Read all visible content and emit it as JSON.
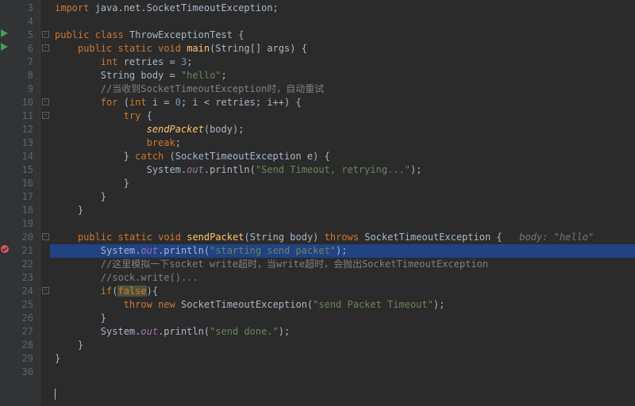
{
  "lines": {
    "start": 3,
    "end": 30
  },
  "code": {
    "l3": {
      "import": "import",
      "pkg": " java.net.SocketTimeoutException;"
    },
    "l5": {
      "k1": "public",
      "k2": "class",
      "cls": "ThrowExceptionTest",
      "brace": " {"
    },
    "l6": {
      "k1": "public",
      "k2": "static",
      "k3": "void",
      "fn": "main",
      "sig": "(String[] args) {"
    },
    "l7": {
      "k1": "int",
      "var": " retries = ",
      "num": "3",
      "semi": ";"
    },
    "l8": {
      "t1": "String body = ",
      "str": "\"hello\"",
      "semi": ";"
    },
    "l9": {
      "cmt": "//当收到SocketTimeoutException时，自动重试"
    },
    "l10": {
      "k1": "for",
      "open": " (",
      "k2": "int",
      "t1": " i = ",
      "n0": "0",
      "t2": "; i < retries; i++) {"
    },
    "l11": {
      "k1": "try",
      "brace": " {"
    },
    "l12": {
      "fn": "sendPacket",
      "t1": "(body);"
    },
    "l13": {
      "k1": "break",
      "semi": ";"
    },
    "l14": {
      "t1": "} ",
      "k1": "catch",
      "t2": " (SocketTimeoutException e) {"
    },
    "l15": {
      "t1": "System.",
      "fld": "out",
      "t2": ".println(",
      "str": "\"Send Timeout, retrying...\"",
      "t3": ");"
    },
    "l16": {
      "brace": "}"
    },
    "l17": {
      "brace": "}"
    },
    "l18": {
      "brace": "}"
    },
    "l20": {
      "k1": "public",
      "k2": "static",
      "k3": "void",
      "fn": "sendPacket",
      "sig1": "(String body) ",
      "k4": "throws",
      "sig2": " SocketTimeoutException {",
      "hint": "   body: \"hello\""
    },
    "l21": {
      "t1": "System.",
      "fld": "out",
      "t2": ".println(",
      "str": "\"starting send packet\"",
      "t3": ");"
    },
    "l22": {
      "cmt": "//这里模拟一下socket write超时，当write超时，会抛出SocketTimeoutException"
    },
    "l23": {
      "cmt": "//sock.write()..."
    },
    "l24": {
      "k1": "if",
      "t1": "(",
      "warn": "false",
      "t2": "){"
    },
    "l25": {
      "k1": "throw",
      "k2": "new",
      "t1": " SocketTimeoutException(",
      "str": "\"send Packet Timeout\"",
      "t2": ");"
    },
    "l26": {
      "brace": "}"
    },
    "l27": {
      "t1": "System.",
      "fld": "out",
      "t2": ".println(",
      "str": "\"send done.\"",
      "t3": ");"
    },
    "l28": {
      "brace": "}"
    },
    "l29": {
      "brace": "}"
    }
  }
}
